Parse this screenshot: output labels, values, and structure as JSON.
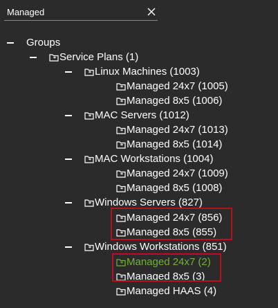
{
  "search": {
    "value": "Managed",
    "clear_icon": "close-icon"
  },
  "tree": {
    "root": {
      "label": "Groups",
      "expanded": true
    },
    "service_plans": {
      "label": "Service Plans (1)",
      "expanded": true
    },
    "linux_machines": {
      "label": "Linux Machines (1003)",
      "children": [
        "Managed 24x7 (1005)",
        "Managed 8x5 (1006)"
      ]
    },
    "mac_servers": {
      "label": "MAC Servers (1012)",
      "children": [
        "Managed 24x7 (1013)",
        "Managed 8x5 (1014)"
      ]
    },
    "mac_workstations": {
      "label": "MAC Workstations (1004)",
      "children": [
        "Managed 24x7 (1009)",
        "Managed 8x5 (1008)"
      ]
    },
    "windows_servers": {
      "label": "Windows Servers (827)",
      "children": [
        "Managed 24x7 (856)",
        "Managed 8x5 (855)"
      ]
    },
    "windows_workstations": {
      "label": "Windows Workstations (851)",
      "children": [
        "Managed 24x7 (2)",
        "Managed 8x5 (3)",
        "Managed HAAS (4)"
      ],
      "selected_child": "Managed 24x7 (2)"
    }
  },
  "colors": {
    "background": "#2b2b2b",
    "text": "#ffffff",
    "selected": "#6fb42f",
    "highlight_border": "#b8101d"
  }
}
